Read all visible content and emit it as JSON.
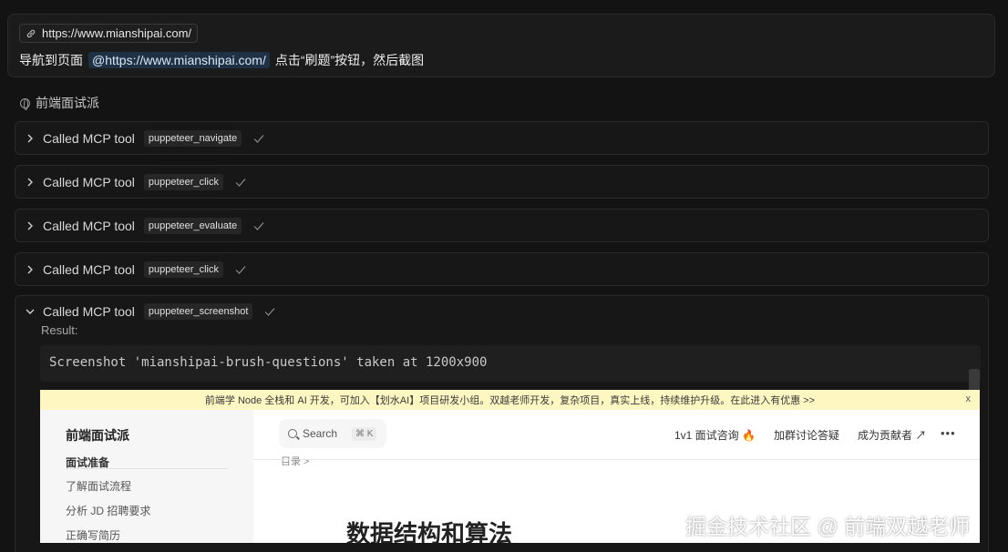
{
  "user_message": {
    "url_chip": "https://www.mianshipai.com/",
    "prompt_before": "导航到页面",
    "mention": "@https://www.mianshipai.com/",
    "prompt_after": "点击“刷题”按钮，然后截图"
  },
  "app_name": "前端面试派",
  "tool_calls": [
    {
      "label": "Called MCP tool",
      "tool": "puppeteer_navigate"
    },
    {
      "label": "Called MCP tool",
      "tool": "puppeteer_click"
    },
    {
      "label": "Called MCP tool",
      "tool": "puppeteer_evaluate"
    },
    {
      "label": "Called MCP tool",
      "tool": "puppeteer_click"
    },
    {
      "label": "Called MCP tool",
      "tool": "puppeteer_screenshot"
    }
  ],
  "result": {
    "label": "Result:",
    "code": "Screenshot 'mianshipai-brush-questions' taken at 1200x900"
  },
  "screenshot": {
    "banner": "前端学 Node 全栈和 AI 开发，可加入【划水AI】项目研发小组。双越老师开发，复杂项目，真实上线，持续维护升级。在此进入有优惠 >>",
    "banner_close": "x",
    "sidebar_title": "前端面试派",
    "sidebar_section": "面试准备",
    "sidebar_items": [
      "了解面试流程",
      "分析 JD 招聘要求",
      "正确写简历"
    ],
    "search_label": "Search",
    "search_kbd": "⌘ K",
    "nav": [
      "1v1 面试咨询 🔥",
      "加群讨论答疑",
      "成为贡献者 ↗"
    ],
    "more": "•••",
    "breadcrumb": "目录 >",
    "heading": "数据结构和算法"
  },
  "watermark": "掘金技术社区 @ 前端双越老师"
}
